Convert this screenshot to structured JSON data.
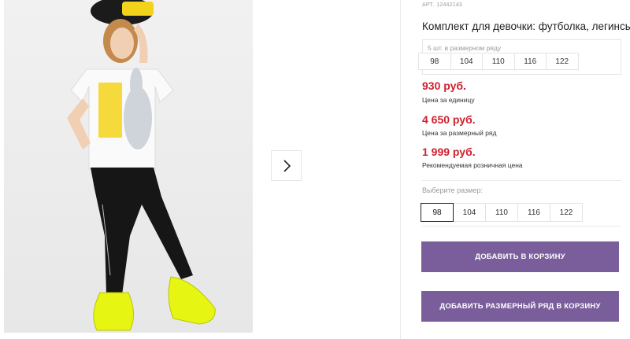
{
  "product": {
    "article_label": "АРТ.",
    "article_value": "12442143",
    "title": "Комплект для девочки: футболка, легинсы"
  },
  "size_range": {
    "label": "5 шт. в размерном ряду",
    "sizes": [
      "98",
      "104",
      "110",
      "116",
      "122"
    ]
  },
  "prices": {
    "unit_price": "930 руб.",
    "unit_price_note": "Цена за единицу",
    "range_price": "4 650 руб.",
    "range_price_note": "Цена за размерный ряд",
    "retail_price": "1 999 руб.",
    "retail_price_note": "Рекомендуемая розничная цена"
  },
  "size_select": {
    "label": "Выберите размер:",
    "sizes": [
      "98",
      "104",
      "110",
      "116",
      "122"
    ],
    "selected": "98"
  },
  "actions": {
    "add_to_cart": "ДОБАВИТЬ В КОРЗИНУ",
    "add_range_to_cart": "ДОБАВИТЬ РАЗМЕРНЫЙ РЯД В КОРЗИНУ"
  },
  "colors": {
    "price_red": "#d01f2e",
    "button_purple": "#7a5e9c"
  },
  "icons": {
    "gallery_next": "chevron-right-icon"
  }
}
